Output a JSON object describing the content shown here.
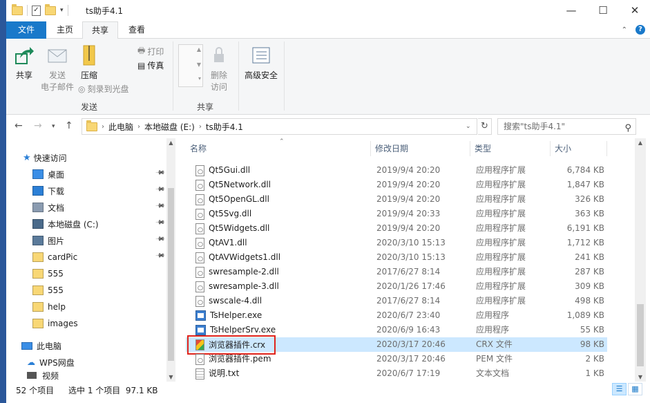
{
  "window": {
    "title": "ts助手4.1",
    "controls": {
      "minimize": "—",
      "maximize": "☐",
      "close": "✕"
    }
  },
  "ribbon_tabs": {
    "file": "文件",
    "home": "主页",
    "share": "共享",
    "view": "查看"
  },
  "ribbon": {
    "send_group": {
      "label": "发送",
      "share": "共享",
      "email_line1": "发送",
      "email_line2": "电子邮件",
      "zip": "压缩",
      "print": "打印",
      "fax": "传真",
      "burn": "刻录到光盘"
    },
    "share_group": {
      "label": "共享",
      "remove_line1": "删除",
      "remove_line2": "访问"
    },
    "advanced_security": "高级安全"
  },
  "address": {
    "crumbs": [
      "此电脑",
      "本地磁盘 (E:)",
      "ts助手4.1"
    ],
    "search_placeholder": "搜索\"ts助手4.1\""
  },
  "nav": {
    "quick_access": "快速访问",
    "items": [
      {
        "label": "桌面",
        "pinned": true
      },
      {
        "label": "下载",
        "pinned": true
      },
      {
        "label": "文档",
        "pinned": true
      },
      {
        "label": "本地磁盘 (C:)",
        "pinned": true
      },
      {
        "label": "图片",
        "pinned": true
      },
      {
        "label": "cardPic",
        "pinned": true
      },
      {
        "label": "555",
        "pinned": false
      },
      {
        "label": "555",
        "pinned": false
      },
      {
        "label": "help",
        "pinned": false
      },
      {
        "label": "images",
        "pinned": false
      }
    ],
    "this_pc": "此电脑",
    "wps": "WPS网盘",
    "video": "视频"
  },
  "columns": {
    "name": "名称",
    "date": "修改日期",
    "type": "类型",
    "size": "大小"
  },
  "files": [
    {
      "name": "Qt5Gui.dll",
      "date": "2019/9/4 20:20",
      "type": "应用程序扩展",
      "size": "6,784 KB",
      "icon": "dll"
    },
    {
      "name": "Qt5Network.dll",
      "date": "2019/9/4 20:20",
      "type": "应用程序扩展",
      "size": "1,847 KB",
      "icon": "dll"
    },
    {
      "name": "Qt5OpenGL.dll",
      "date": "2019/9/4 20:20",
      "type": "应用程序扩展",
      "size": "326 KB",
      "icon": "dll"
    },
    {
      "name": "Qt5Svg.dll",
      "date": "2019/9/4 20:33",
      "type": "应用程序扩展",
      "size": "363 KB",
      "icon": "dll"
    },
    {
      "name": "Qt5Widgets.dll",
      "date": "2019/9/4 20:20",
      "type": "应用程序扩展",
      "size": "6,191 KB",
      "icon": "dll"
    },
    {
      "name": "QtAV1.dll",
      "date": "2020/3/10 15:13",
      "type": "应用程序扩展",
      "size": "1,712 KB",
      "icon": "dll"
    },
    {
      "name": "QtAVWidgets1.dll",
      "date": "2020/3/10 15:13",
      "type": "应用程序扩展",
      "size": "241 KB",
      "icon": "dll"
    },
    {
      "name": "swresample-2.dll",
      "date": "2017/6/27 8:14",
      "type": "应用程序扩展",
      "size": "287 KB",
      "icon": "dll"
    },
    {
      "name": "swresample-3.dll",
      "date": "2020/1/26 17:46",
      "type": "应用程序扩展",
      "size": "309 KB",
      "icon": "dll"
    },
    {
      "name": "swscale-4.dll",
      "date": "2017/6/27 8:14",
      "type": "应用程序扩展",
      "size": "498 KB",
      "icon": "dll"
    },
    {
      "name": "TsHelper.exe",
      "date": "2020/6/7 23:40",
      "type": "应用程序",
      "size": "1,089 KB",
      "icon": "exe"
    },
    {
      "name": "TsHelperSrv.exe",
      "date": "2020/6/9 16:43",
      "type": "应用程序",
      "size": "55 KB",
      "icon": "exe"
    },
    {
      "name": "浏览器插件.crx",
      "date": "2020/3/17 20:46",
      "type": "CRX 文件",
      "size": "98 KB",
      "icon": "crx",
      "selected": true
    },
    {
      "name": "浏览器插件.pem",
      "date": "2020/3/17 20:46",
      "type": "PEM 文件",
      "size": "2 KB",
      "icon": "dll"
    },
    {
      "name": "说明.txt",
      "date": "2020/6/7 17:19",
      "type": "文本文档",
      "size": "1 KB",
      "icon": "txt"
    }
  ],
  "status": {
    "count": "52 个项目",
    "selected": "选中 1 个项目  97.1 KB"
  }
}
